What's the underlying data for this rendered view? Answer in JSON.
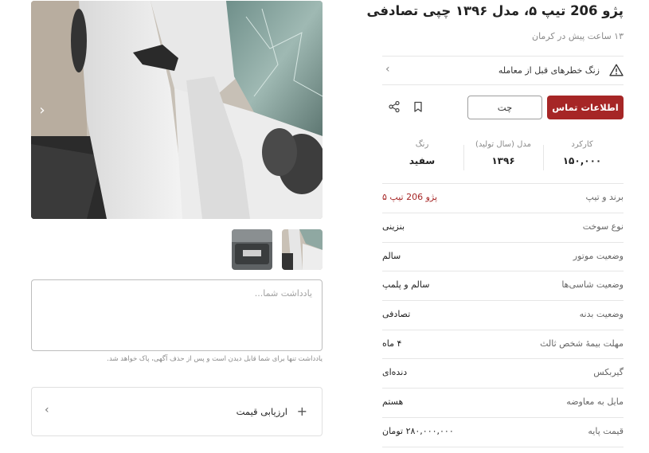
{
  "listing": {
    "title": "پژو 206 تیپ ۵، مدل ۱۳۹۶ چپی تصادفی",
    "subtitle": "۱۳ ساعت پیش در کرمان"
  },
  "warning": {
    "text": "زنگ خطرهای قبل از معامله",
    "icon": "warning-triangle-icon"
  },
  "actions": {
    "contact_label": "اطلاعات تماس",
    "chat_label": "چت",
    "bookmark_icon": "bookmark-icon",
    "share_icon": "share-icon"
  },
  "stats": [
    {
      "label": "کارکرد",
      "value": "۱۵۰,۰۰۰"
    },
    {
      "label": "مدل (سال تولید)",
      "value": "۱۳۹۶"
    },
    {
      "label": "رنگ",
      "value": "سفید"
    }
  ],
  "specs": [
    {
      "key": "برند و تیپ",
      "value": "پژو 206 تیپ ۵"
    },
    {
      "key": "نوع سوخت",
      "value": "بنزینی"
    },
    {
      "key": "وضعیت موتور",
      "value": "سالم"
    },
    {
      "key": "وضعیت شاسی‌ها",
      "value": "سالم و پلمپ"
    },
    {
      "key": "وضعیت بدنه",
      "value": "تصادفی"
    },
    {
      "key": "مهلت بیمهٔ شخص ثالث",
      "value": "۴ ماه"
    },
    {
      "key": "گیربکس",
      "value": "دنده‌ای"
    },
    {
      "key": "مایل به معاوضه",
      "value": "هستم"
    },
    {
      "key": "قیمت پایه",
      "value": "۲۸۰,۰۰۰,۰۰۰ تومان"
    }
  ],
  "gallery": {
    "next_icon": "chevron-right-icon"
  },
  "note": {
    "placeholder": "یادداشت شما...",
    "help": "یادداشت تنها برای شما قابل دیدن است و پس از حذف آگهی، پاک خواهد شد."
  },
  "price_eval": {
    "label": "ارزیابی قیمت",
    "plus_icon": "plus-icon",
    "chevron_icon": "chevron-left-icon"
  },
  "colors": {
    "accent": "#a62626",
    "divider": "#e6e6e6",
    "muted": "#8a8a8a"
  }
}
